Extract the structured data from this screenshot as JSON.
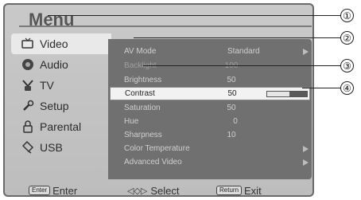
{
  "menu": {
    "title": "Menu"
  },
  "sidebar": {
    "items": [
      {
        "label": "Video",
        "icon": "tv-screen-icon"
      },
      {
        "label": "Audio",
        "icon": "speaker-icon"
      },
      {
        "label": "TV",
        "icon": "antenna-icon"
      },
      {
        "label": "Setup",
        "icon": "wrench-icon"
      },
      {
        "label": "Parental",
        "icon": "lock-icon"
      },
      {
        "label": "USB",
        "icon": "usb-icon"
      }
    ]
  },
  "settings": [
    {
      "label": "AV Mode",
      "value": "Standard",
      "arrow": true
    },
    {
      "label": "Backlight",
      "value": "100"
    },
    {
      "label": "Brightness",
      "value": "50"
    },
    {
      "label": "Contrast",
      "value": "50",
      "selected": true,
      "level": 0.55
    },
    {
      "label": "Saturation",
      "value": "50"
    },
    {
      "label": "Hue",
      "value": "0"
    },
    {
      "label": "Sharpness",
      "value": "10"
    },
    {
      "label": "Color Temperature",
      "arrow": true
    },
    {
      "label": "Advanced Video",
      "arrow": true
    }
  ],
  "footer": {
    "enter_key": "Enter",
    "enter_label": "Enter",
    "select_label": "Select",
    "return_key": "Return",
    "exit_label": "Exit"
  },
  "callouts": [
    "①",
    "②",
    "③",
    "④"
  ]
}
